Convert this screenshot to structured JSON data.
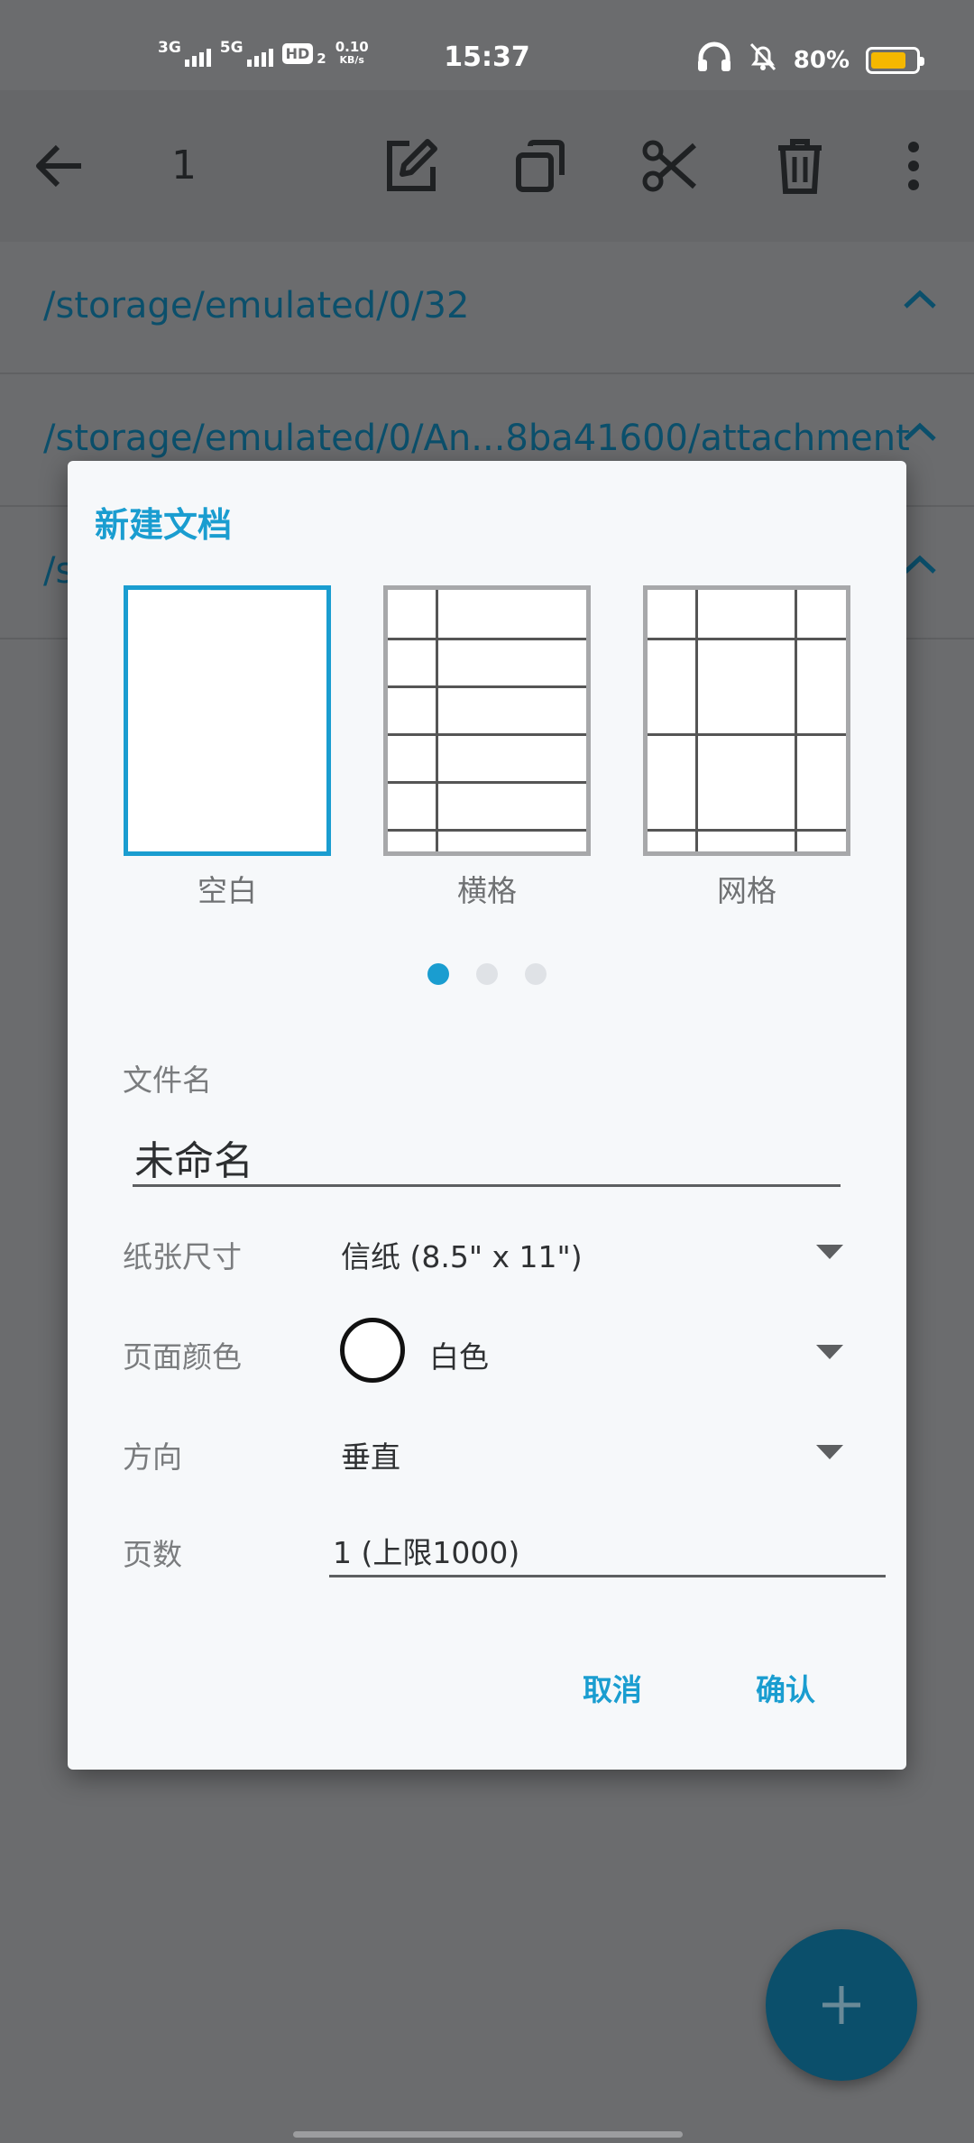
{
  "status_bar": {
    "net1": "3G",
    "net2": "5G",
    "hd": "HD",
    "hd_sub": "2",
    "speed_value": "0.10",
    "speed_unit": "KB/s",
    "time": "15:37",
    "battery": "80%",
    "battery_level": 0.8,
    "battery_color": "#f5b800"
  },
  "toolbar": {
    "selected_count": "1",
    "icons": [
      "back-arrow-icon",
      "edit-icon",
      "copy-icon",
      "cut-icon",
      "delete-icon",
      "more-vert-icon"
    ]
  },
  "folders": [
    {
      "path": "/storage/emulated/0/32"
    },
    {
      "path": "/storage/emulated/0/An...8ba41600/attachment"
    },
    {
      "path": "/s"
    }
  ],
  "dialog": {
    "title": "新建文档",
    "templates": [
      {
        "name": "空白",
        "selected": true
      },
      {
        "name": "横格",
        "selected": false
      },
      {
        "name": "网格",
        "selected": false
      }
    ],
    "page_indicator": {
      "count": 3,
      "active": 1
    },
    "filename_label": "文件名",
    "filename_value": "未命名",
    "paper_size_label": "纸张尺寸",
    "paper_size_value": "信纸 (8.5\" x 11\")",
    "page_color_label": "页面颜色",
    "page_color_value": "白色",
    "page_color_swatch": "#ffffff",
    "orientation_label": "方向",
    "orientation_value": "垂直",
    "page_count_label": "页数",
    "page_count_value": "1 (上限1000)",
    "cancel_label": "取消",
    "confirm_label": "确认"
  },
  "colors": {
    "accent": "#1a9dd0",
    "scrim": "#6b6c6e",
    "fab": "#0b4f6b"
  }
}
